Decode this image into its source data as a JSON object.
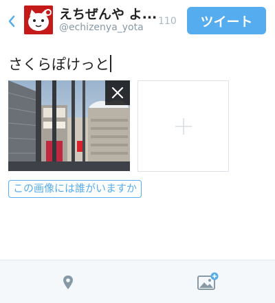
{
  "header": {
    "display_name": "えちぜんや よ...",
    "username": "@echizenya_yota",
    "char_count": "110",
    "tweet_label": "ツイート"
  },
  "compose": {
    "text": "さくらぽけっと"
  },
  "attachments": {
    "tag_people_label": "この画像には誰がいますか"
  },
  "icons": {
    "back": "chevron-left-icon",
    "remove": "close-icon",
    "add": "plus-icon",
    "location": "map-pin-icon",
    "media": "add-image-icon"
  },
  "colors": {
    "accent": "#55acee",
    "text": "#222222",
    "muted": "#8899a6",
    "bar": "#f5f8fa"
  }
}
